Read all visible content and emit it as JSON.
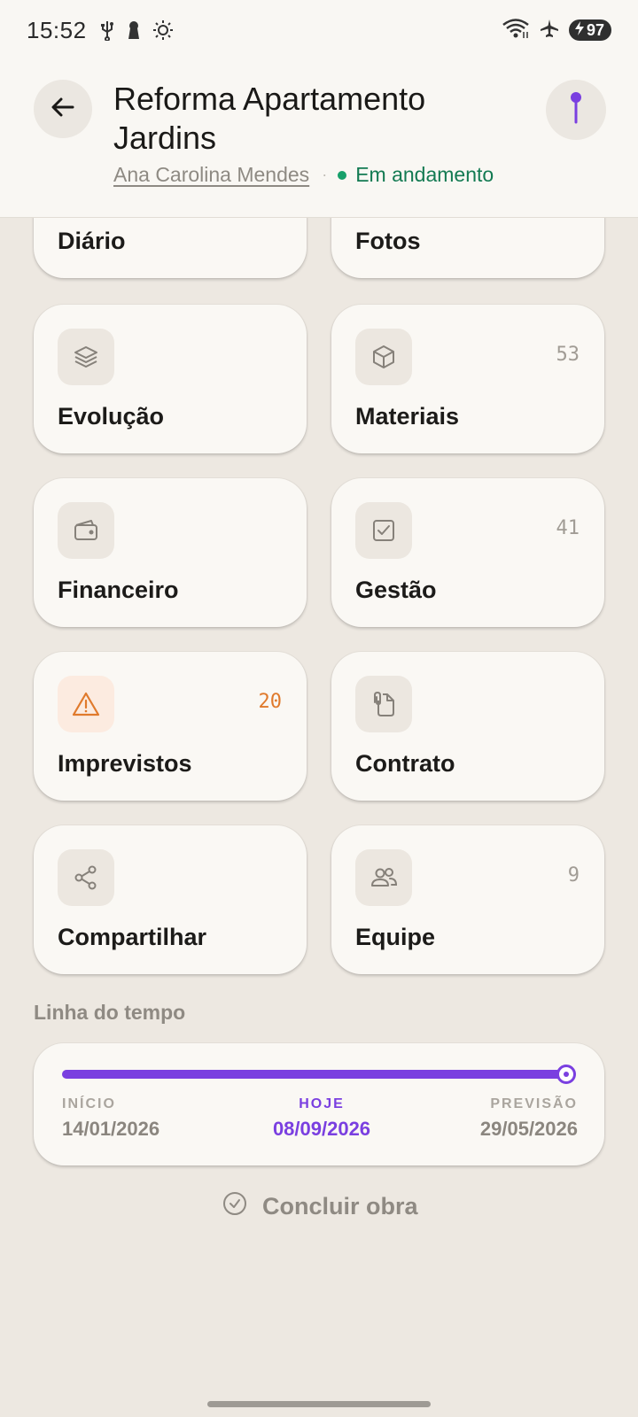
{
  "status_bar": {
    "time": "15:52",
    "battery": "97",
    "icons": [
      "usb-icon",
      "keyhole-icon",
      "brightness-icon",
      "wifi-icon",
      "airplane-icon",
      "battery-charging-icon"
    ]
  },
  "header": {
    "title": "Reforma Apartamento Jardins",
    "client": "Ana Carolina Mendes",
    "separator": "·",
    "status": "Em andamento",
    "status_color": "#17a06a",
    "back_icon": "arrow-left-icon",
    "pin_icon": "map-pin-icon",
    "pin_color": "#7a3fe0"
  },
  "modules": [
    {
      "label": "Diário",
      "count": "",
      "icon": "book-icon"
    },
    {
      "label": "Fotos",
      "count": "",
      "icon": "camera-icon"
    },
    {
      "label": "Evolução",
      "count": "",
      "icon": "layers-icon"
    },
    {
      "label": "Materiais",
      "count": "53",
      "icon": "box-icon"
    },
    {
      "label": "Financeiro",
      "count": "",
      "icon": "wallet-icon"
    },
    {
      "label": "Gestão",
      "count": "41",
      "icon": "checkbox-icon"
    },
    {
      "label": "Imprevistos",
      "count": "20",
      "icon": "warning-icon",
      "accent": "#e07a2c"
    },
    {
      "label": "Contrato",
      "count": "",
      "icon": "document-clip-icon"
    },
    {
      "label": "Compartilhar",
      "count": "",
      "icon": "share-icon"
    },
    {
      "label": "Equipe",
      "count": "9",
      "icon": "users-icon"
    }
  ],
  "timeline": {
    "section_title": "Linha do tempo",
    "progress_percent": 100,
    "start_label": "INÍCIO",
    "start_date": "14/01/2026",
    "today_label": "HOJE",
    "today_date": "08/09/2026",
    "end_label": "PREVISÃO",
    "end_date": "29/05/2026",
    "accent": "#7a3fe0"
  },
  "actions": {
    "finish_label": "Concluir obra",
    "finish_icon": "check-circle-icon"
  }
}
